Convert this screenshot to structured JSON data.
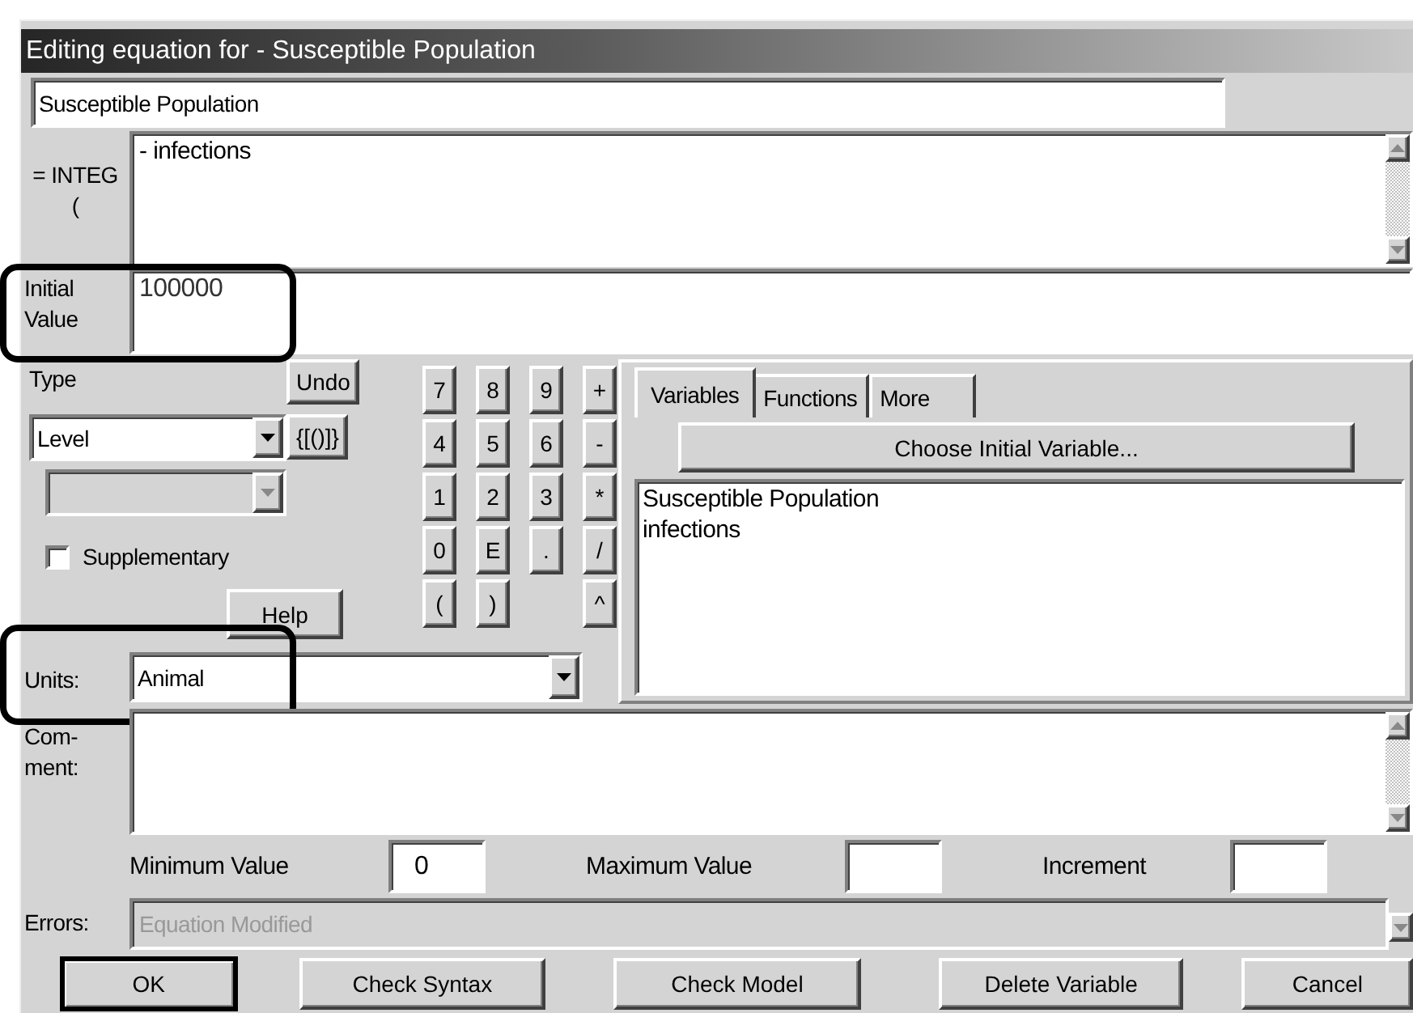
{
  "window": {
    "title": "Editing equation for - Susceptible Population"
  },
  "name_field": {
    "value": "Susceptible Population"
  },
  "equation": {
    "label": "= INTEG (",
    "value": "- infections"
  },
  "initial_value": {
    "label": "Initial Value",
    "value": "100000",
    "highlighted": true
  },
  "type": {
    "label": "Type",
    "value": "Level",
    "subtype_disabled": true
  },
  "supplementary": {
    "label": "Supplementary",
    "checked": false
  },
  "edit_buttons": [
    {
      "label": "Undo"
    },
    {
      "label": "{[()]}"
    }
  ],
  "help_button": {
    "label": "Help"
  },
  "keypad": [
    [
      {
        "kind": "key",
        "label": "7"
      },
      {
        "kind": "key",
        "label": "8"
      },
      {
        "kind": "key",
        "label": "9"
      },
      {
        "kind": "key",
        "label": "+"
      }
    ],
    [
      {
        "kind": "key",
        "label": "4"
      },
      {
        "kind": "key",
        "label": "5"
      },
      {
        "kind": "key",
        "label": "6"
      },
      {
        "kind": "key",
        "label": "-"
      }
    ],
    [
      {
        "kind": "key",
        "label": "1"
      },
      {
        "kind": "key",
        "label": "2"
      },
      {
        "kind": "key",
        "label": "3"
      },
      {
        "kind": "key",
        "label": "*"
      }
    ],
    [
      {
        "kind": "key",
        "label": "0"
      },
      {
        "kind": "key",
        "label": "E"
      },
      {
        "kind": "key",
        "label": "."
      },
      {
        "kind": "key",
        "label": "/"
      }
    ],
    [
      {
        "kind": "key",
        "label": "("
      },
      {
        "kind": "key",
        "label": ")"
      },
      {
        "kind": "gap"
      },
      {
        "kind": "key",
        "label": "^"
      }
    ]
  ],
  "units": {
    "label": "Units:",
    "value": "Animal",
    "highlighted": true
  },
  "tabs": [
    {
      "label": "Variables",
      "selected": true
    },
    {
      "label": "Functions",
      "selected": false
    },
    {
      "label": "More",
      "selected": false
    }
  ],
  "choose_button": {
    "label": "Choose Initial Variable..."
  },
  "variables": [
    "Susceptible Population",
    "infections"
  ],
  "comment": {
    "label": "Com- ment:"
  },
  "range": [
    {
      "label": "Minimum Value",
      "value": "0"
    },
    {
      "label": "Maximum Value"
    },
    {
      "label": "Increment"
    }
  ],
  "errors": {
    "label": "Errors:",
    "value": "Equation Modified",
    "disabled": true
  },
  "actions": [
    {
      "label": "OK",
      "default": true
    },
    {
      "label": "Check Syntax",
      "default": false
    },
    {
      "label": "Check Model",
      "default": false
    },
    {
      "label": "Delete Variable",
      "default": false
    },
    {
      "label": "Cancel",
      "default": false
    }
  ]
}
